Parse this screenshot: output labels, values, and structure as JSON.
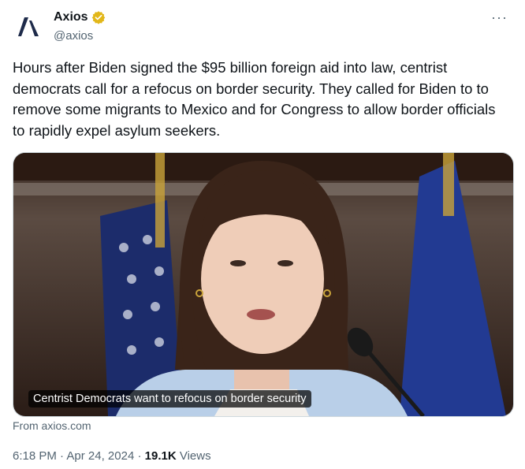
{
  "author": {
    "display_name": "Axios",
    "handle": "@axios",
    "logo_color": "#1e2b4a",
    "verified_color": "#e2b719"
  },
  "menu": {
    "icon": "more-dots-icon"
  },
  "tweet": {
    "text": "Hours after Biden signed the $95 billion foreign aid into law, centrist democrats call for a refocus on border security. They called for Biden to to remove some migrants to Mexico and for Congress to allow border officials to rapidly expel asylum seekers."
  },
  "card": {
    "caption": "Centrist Democrats want to refocus on border security",
    "source": "From axios.com"
  },
  "meta": {
    "time": "6:18 PM",
    "date": "Apr 24, 2024",
    "views_count": "19.1K",
    "views_label": "Views",
    "separator": "·"
  }
}
